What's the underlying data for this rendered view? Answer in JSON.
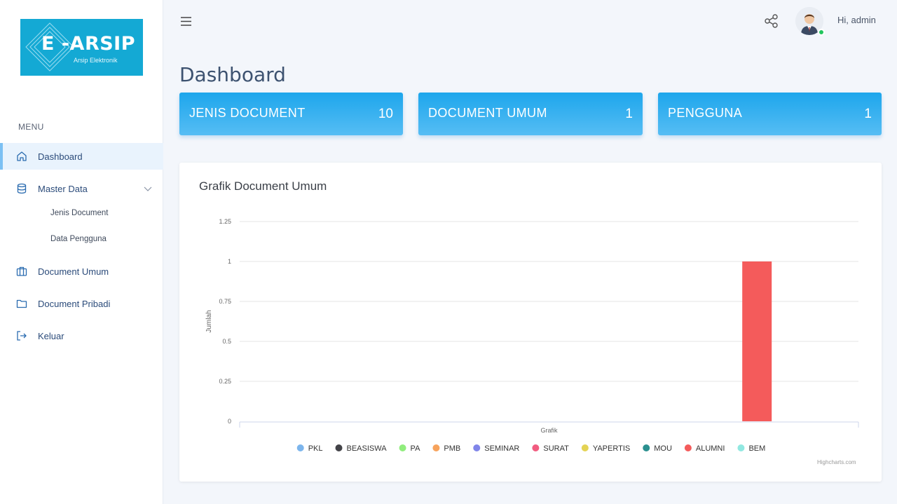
{
  "brand": {
    "logo_text": "E -ARSIP",
    "tagline": "Arsip Elektronik"
  },
  "sidebar": {
    "menu_title": "MENU",
    "items": [
      {
        "label": "Dashboard",
        "icon": "home-icon"
      },
      {
        "label": "Master Data",
        "icon": "database-icon"
      },
      {
        "label": "Document Umum",
        "icon": "briefcase-icon"
      },
      {
        "label": "Document Pribadi",
        "icon": "folder-icon"
      },
      {
        "label": "Keluar",
        "icon": "logout-icon"
      }
    ],
    "subitems": [
      {
        "label": "Jenis Document"
      },
      {
        "label": "Data Pengguna"
      }
    ]
  },
  "header": {
    "greeting": "Hi, admin"
  },
  "page": {
    "title": "Dashboard"
  },
  "cards": [
    {
      "title": "JENIS DOCUMENT",
      "count": "10"
    },
    {
      "title": "DOCUMENT UMUM",
      "count": "1"
    },
    {
      "title": "PENGGUNA",
      "count": "1"
    }
  ],
  "chart_panel": {
    "title": "Grafik Document Umum",
    "credit": "Highcharts.com"
  },
  "chart_data": {
    "type": "bar",
    "categories": [
      "Grafik"
    ],
    "ylabel": "Jumlah",
    "xlabel": "",
    "ylim": [
      0,
      1.25
    ],
    "yticks": [
      "0",
      "0.25",
      "0.5",
      "0.75",
      "1",
      "1.25"
    ],
    "grid": true,
    "legend_position": "bottom",
    "series": [
      {
        "name": "PKL",
        "values": [
          0
        ],
        "color": "#7cb5ec"
      },
      {
        "name": "BEASISWA",
        "values": [
          0
        ],
        "color": "#434348"
      },
      {
        "name": "PA",
        "values": [
          0
        ],
        "color": "#90ed7d"
      },
      {
        "name": "PMB",
        "values": [
          0
        ],
        "color": "#f7a35c"
      },
      {
        "name": "SEMINAR",
        "values": [
          0
        ],
        "color": "#8085e9"
      },
      {
        "name": "SURAT",
        "values": [
          0
        ],
        "color": "#f15c80"
      },
      {
        "name": "YAPERTIS",
        "values": [
          0
        ],
        "color": "#e4d354"
      },
      {
        "name": "MOU",
        "values": [
          0
        ],
        "color": "#2b908f"
      },
      {
        "name": "ALUMNI",
        "values": [
          1
        ],
        "color": "#f45b5b"
      },
      {
        "name": "BEM",
        "values": [
          0
        ],
        "color": "#91e8e1"
      }
    ]
  }
}
